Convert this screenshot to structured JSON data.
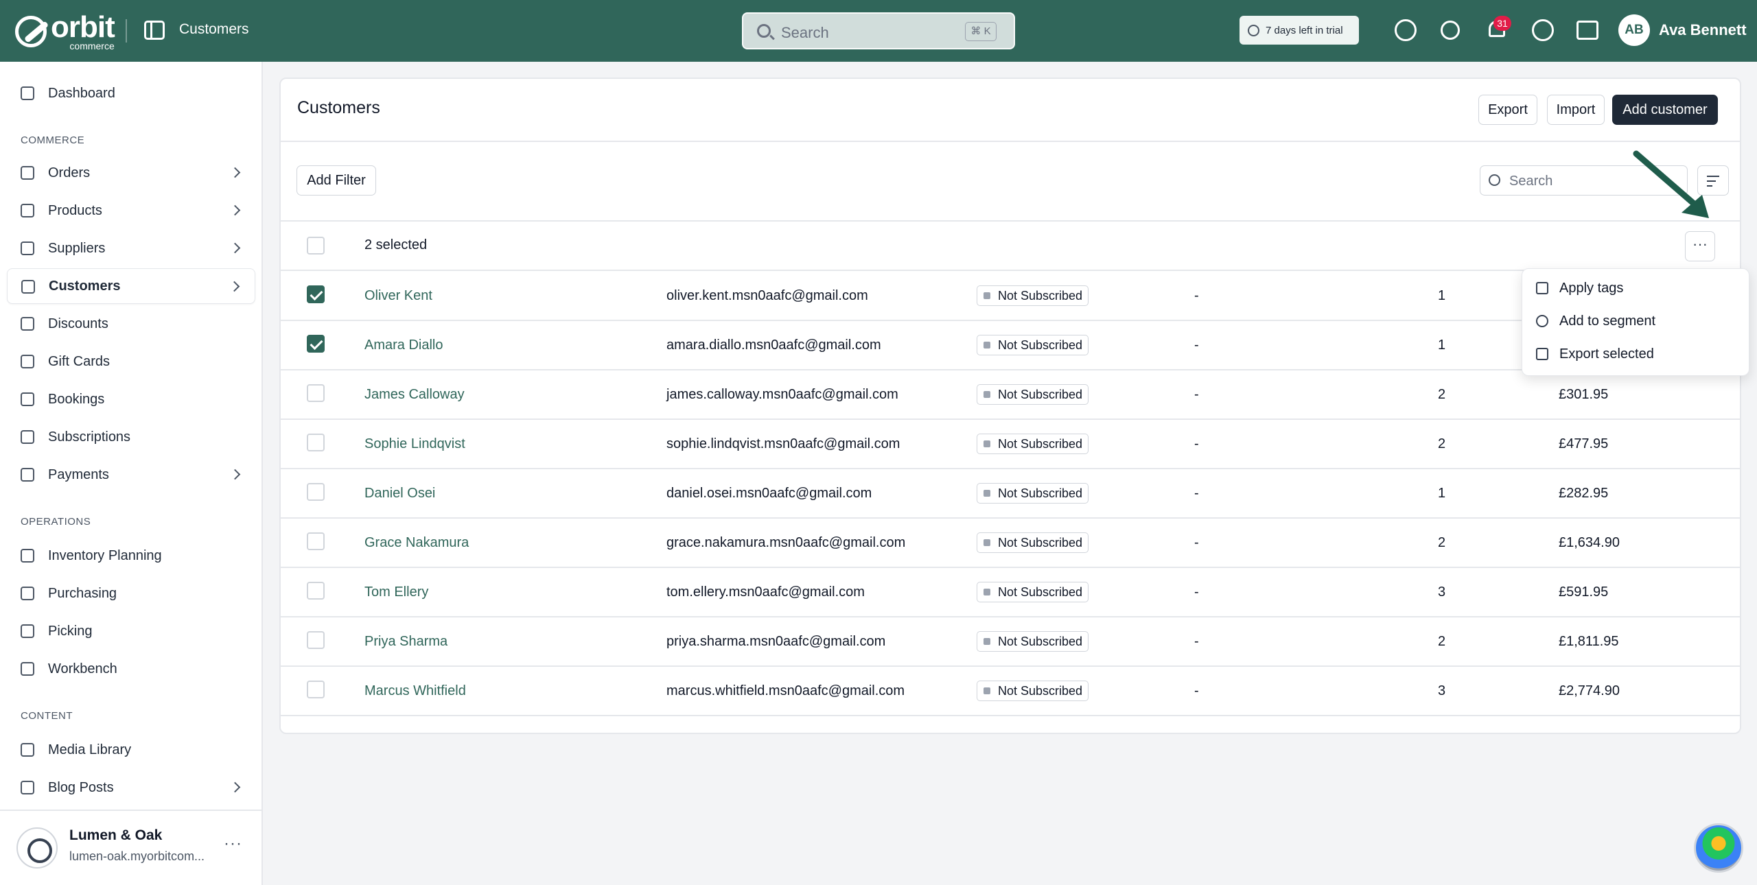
{
  "header": {
    "logo_text": "orbit",
    "logo_subtext": "commerce",
    "title": "Customers",
    "search_placeholder": "Search",
    "search_shortcut": "⌘ K",
    "trial_text": "7 days left in trial",
    "notification_count": "31",
    "user_initials": "AB",
    "user_name": "Ava Bennett"
  },
  "sidebar": {
    "dashboard": "Dashboard",
    "section_commerce": "COMMERCE",
    "commerce_items": [
      {
        "label": "Orders"
      },
      {
        "label": "Products"
      },
      {
        "label": "Suppliers"
      },
      {
        "label": "Customers"
      },
      {
        "label": "Discounts"
      },
      {
        "label": "Gift Cards"
      },
      {
        "label": "Bookings"
      },
      {
        "label": "Subscriptions"
      },
      {
        "label": "Payments"
      }
    ],
    "section_operations": "OPERATIONS",
    "operations_items": [
      {
        "label": "Inventory Planning"
      },
      {
        "label": "Purchasing"
      },
      {
        "label": "Picking"
      },
      {
        "label": "Workbench"
      }
    ],
    "section_content": "CONTENT",
    "content_items": [
      {
        "label": "Media Library"
      },
      {
        "label": "Blog Posts"
      }
    ],
    "store_name": "Lumen & Oak",
    "store_url": "lumen-oak.myorbitcom..."
  },
  "main": {
    "title": "Customers",
    "export_label": "Export",
    "import_label": "Import",
    "add_customer_label": "Add customer",
    "add_filter_label": "Add Filter",
    "table_search_placeholder": "Search",
    "selected_text": "2 selected",
    "rows": [
      {
        "name": "Oliver Kent",
        "email": "oliver.kent.msn0aafc@gmail.com",
        "subscription": "Not Subscribed",
        "location": "-",
        "orders": "1",
        "spent": "",
        "checked": true
      },
      {
        "name": "Amara Diallo",
        "email": "amara.diallo.msn0aafc@gmail.com",
        "subscription": "Not Subscribed",
        "location": "-",
        "orders": "1",
        "spent": "",
        "checked": true
      },
      {
        "name": "James Calloway",
        "email": "james.calloway.msn0aafc@gmail.com",
        "subscription": "Not Subscribed",
        "location": "-",
        "orders": "2",
        "spent": "£301.95",
        "checked": false
      },
      {
        "name": "Sophie Lindqvist",
        "email": "sophie.lindqvist.msn0aafc@gmail.com",
        "subscription": "Not Subscribed",
        "location": "-",
        "orders": "2",
        "spent": "£477.95",
        "checked": false
      },
      {
        "name": "Daniel Osei",
        "email": "daniel.osei.msn0aafc@gmail.com",
        "subscription": "Not Subscribed",
        "location": "-",
        "orders": "1",
        "spent": "£282.95",
        "checked": false
      },
      {
        "name": "Grace Nakamura",
        "email": "grace.nakamura.msn0aafc@gmail.com",
        "subscription": "Not Subscribed",
        "location": "-",
        "orders": "2",
        "spent": "£1,634.90",
        "checked": false
      },
      {
        "name": "Tom Ellery",
        "email": "tom.ellery.msn0aafc@gmail.com",
        "subscription": "Not Subscribed",
        "location": "-",
        "orders": "3",
        "spent": "£591.95",
        "checked": false
      },
      {
        "name": "Priya Sharma",
        "email": "priya.sharma.msn0aafc@gmail.com",
        "subscription": "Not Subscribed",
        "location": "-",
        "orders": "2",
        "spent": "£1,811.95",
        "checked": false
      },
      {
        "name": "Marcus Whitfield",
        "email": "marcus.whitfield.msn0aafc@gmail.com",
        "subscription": "Not Subscribed",
        "location": "-",
        "orders": "3",
        "spent": "£2,774.90",
        "checked": false
      }
    ],
    "bulk_menu": {
      "items": [
        {
          "label": "Apply tags",
          "icon": "tag-icon"
        },
        {
          "label": "Add to segment",
          "icon": "users-icon"
        },
        {
          "label": "Export selected",
          "icon": "upload-icon"
        }
      ]
    }
  },
  "colors": {
    "brand": "#30665a",
    "badge": "#e11d48",
    "annotation_arrow": "#1f5c4b"
  }
}
